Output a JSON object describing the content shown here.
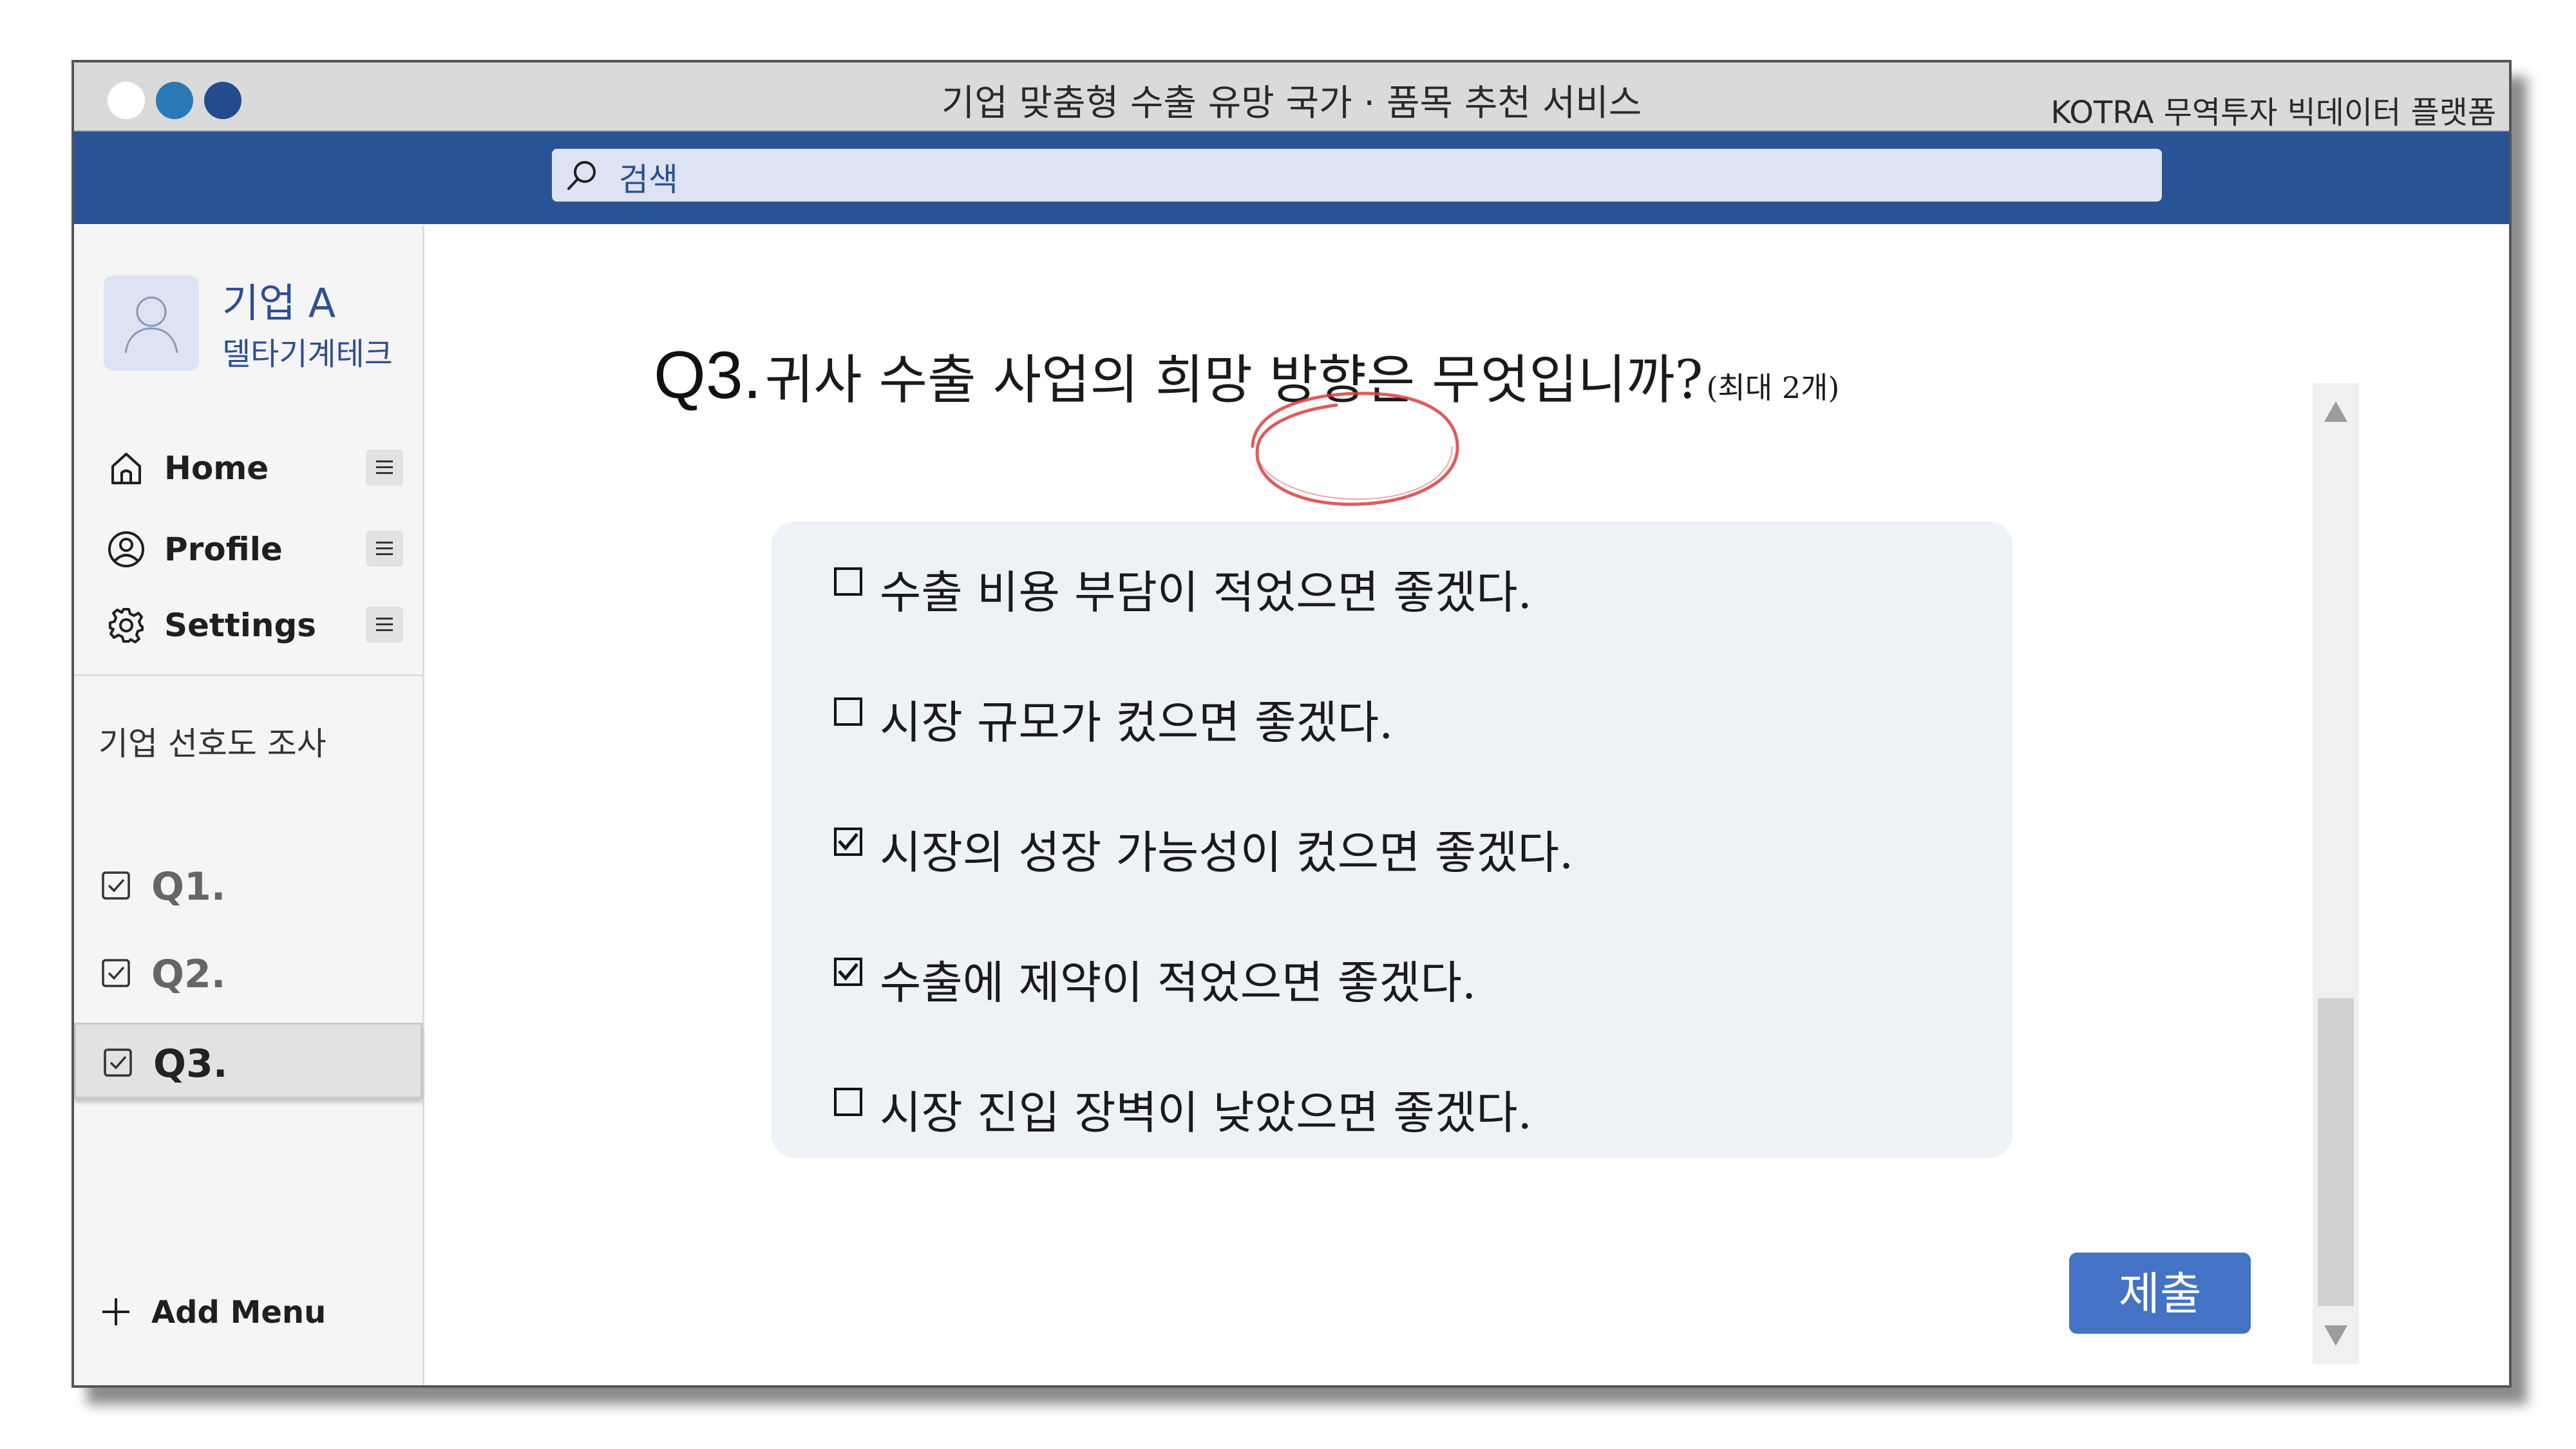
{
  "window": {
    "title": "기업 맞춤형 수출 유망 국가 · 품목 추천 서비스",
    "platform": "KOTRA 무역투자 빅데이터 플랫폼"
  },
  "search": {
    "placeholder": "검색",
    "icon": "search-icon"
  },
  "profile": {
    "name": "기업 A",
    "subtitle": "델타기계테크",
    "icon": "user-icon"
  },
  "nav": [
    {
      "label": "Home",
      "icon": "home-icon"
    },
    {
      "label": "Profile",
      "icon": "profile-icon"
    },
    {
      "label": "Settings",
      "icon": "gear-icon"
    }
  ],
  "survey": {
    "title": "기업 선호도 조사",
    "questions": [
      {
        "label": "Q1.",
        "checked": true,
        "active": false
      },
      {
        "label": "Q2.",
        "checked": true,
        "active": false
      },
      {
        "label": "Q3.",
        "checked": true,
        "active": true
      }
    ]
  },
  "add_menu": "Add Menu",
  "question": {
    "number": "Q3.",
    "text": "귀사 수출 사업의 희망 방향은 무엇입니까?",
    "note": "(최대 2개)",
    "options": [
      {
        "text": "수출 비용 부담이 적었으면 좋겠다.",
        "checked": false
      },
      {
        "text": "시장 규모가 컸으면 좋겠다.",
        "checked": false
      },
      {
        "text": "시장의 성장 가능성이 컸으면 좋겠다.",
        "checked": true
      },
      {
        "text": "수출에 제약이 적었으면 좋겠다.",
        "checked": true
      },
      {
        "text": "시장 진입 장벽이 낮았으면 좋겠다.",
        "checked": false
      }
    ]
  },
  "submit_label": "제출",
  "colors": {
    "accent": "#2a5395",
    "button": "#4472c4",
    "annotation": "#d94040"
  }
}
